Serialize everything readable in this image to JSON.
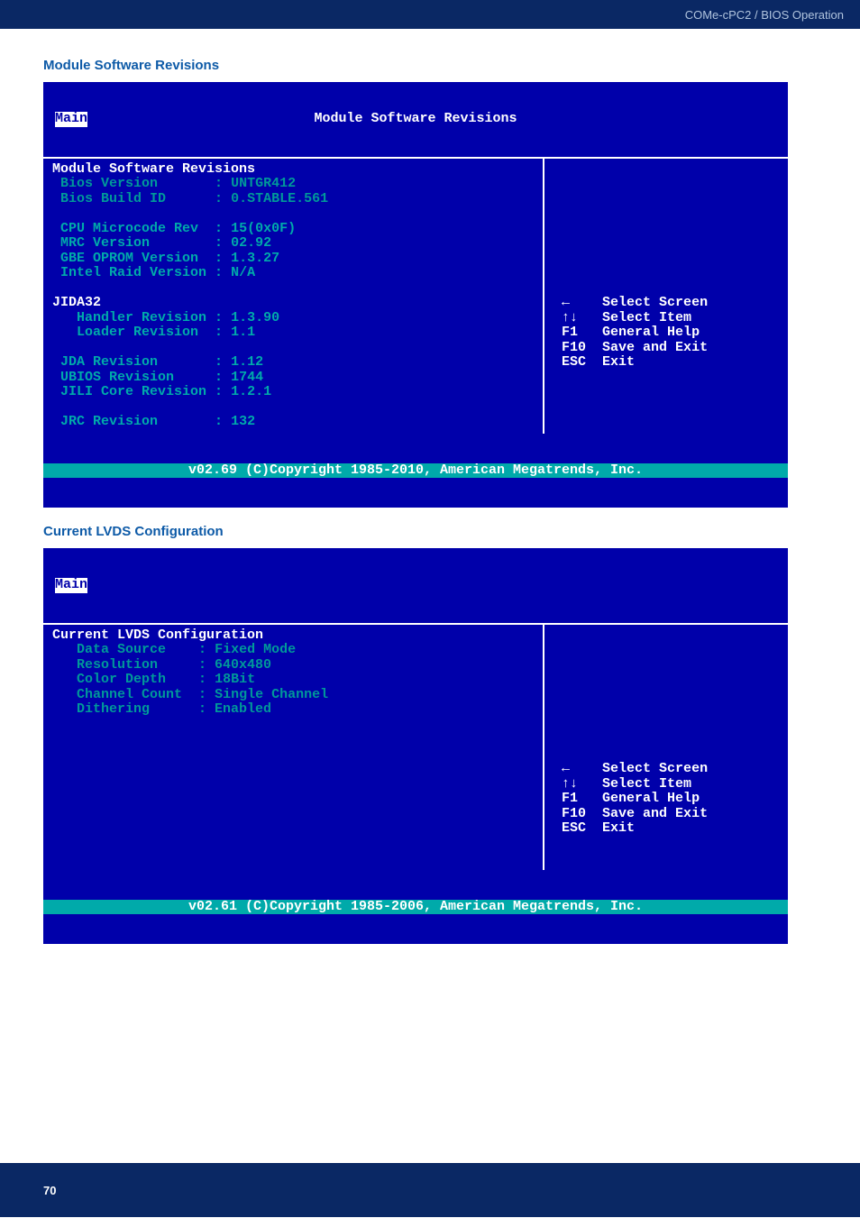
{
  "header": {
    "breadcrumb": "COMe-cPC2 / BIOS Operation"
  },
  "section1": {
    "title": "Module Software Revisions",
    "bios_title": "Module Software Revisions",
    "tab": "Main",
    "lines": {
      "heading": "Module Software Revisions",
      "bios_version_label": "Bios Version",
      "bios_version_val": "UNTGR412",
      "bios_build_label": "Bios Build ID",
      "bios_build_val": "0.STABLE.561",
      "cpu_mc_label": "CPU Microcode Rev",
      "cpu_mc_val": "15(0x0F)",
      "mrc_label": "MRC Version",
      "mrc_val": "02.92",
      "gbe_label": "GBE OPROM Version",
      "gbe_val": "1.3.27",
      "raid_label": "Intel Raid Version",
      "raid_val": "N/A",
      "jida_heading": "JIDA32",
      "handler_label": "Handler Revision",
      "handler_val": "1.3.90",
      "loader_label": "Loader Revision",
      "loader_val": "1.1",
      "jda_label": "JDA Revision",
      "jda_val": "1.12",
      "ubios_label": "UBIOS Revision",
      "ubios_val": "1744",
      "jili_label": "JILI Core Revision",
      "jili_val": "1.2.1",
      "jrc_label": "JRC Revision",
      "jrc_val": "132"
    },
    "legend": {
      "l1k": "←",
      "l1v": "Select Screen",
      "l2k": "↑↓",
      "l2v": "Select Item",
      "l3k": "F1",
      "l3v": "General Help",
      "l4k": "F10",
      "l4v": "Save and Exit",
      "l5k": "ESC",
      "l5v": "Exit"
    },
    "copyright": "v02.69 (C)Copyright 1985-2010, American Megatrends, Inc."
  },
  "section2": {
    "title": "Current LVDS Configuration",
    "tab": "Main",
    "lines": {
      "heading": "Current LVDS Configuration",
      "data_source_label": "Data Source",
      "data_source_val": "Fixed Mode",
      "resolution_label": "Resolution",
      "resolution_val": "640x480",
      "color_depth_label": "Color Depth",
      "color_depth_val": "18Bit",
      "channel_label": "Channel Count",
      "channel_val": "Single Channel",
      "dithering_label": "Dithering",
      "dithering_val": "Enabled"
    },
    "legend": {
      "l1k": "←",
      "l1v": "Select Screen",
      "l2k": "↑↓",
      "l2v": "Select Item",
      "l3k": "F1",
      "l3v": "General Help",
      "l4k": "F10",
      "l4v": "Save and Exit",
      "l5k": "ESC",
      "l5v": "Exit"
    },
    "copyright": "v02.61 (C)Copyright 1985-2006, American Megatrends, Inc."
  },
  "page_number": "70"
}
